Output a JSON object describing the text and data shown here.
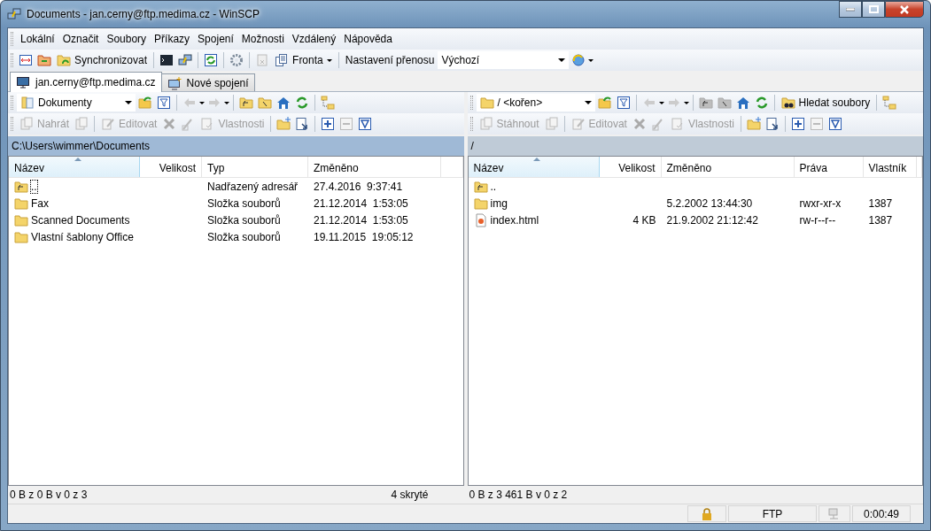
{
  "window": {
    "title": "Documents - jan.cerny@ftp.medima.cz - WinSCP"
  },
  "menu": [
    "Lokální",
    "Označit",
    "Soubory",
    "Příkazy",
    "Spojení",
    "Možnosti",
    "Vzdálený",
    "Nápověda"
  ],
  "toolbar": {
    "sync_label": "Synchronizovat",
    "queue_label": "Fronta",
    "transfer_label": "Nastavení přenosu",
    "transfer_value": "Výchozí"
  },
  "session_tabs": [
    {
      "label": "jan.cerny@ftp.medima.cz",
      "selected": true,
      "kind": "session"
    },
    {
      "label": "Nové spojení",
      "selected": false,
      "kind": "new"
    }
  ],
  "panels": [
    {
      "active": true,
      "location": "Dokumenty",
      "kind": "local",
      "path": "C:\\Users\\wimmer\\Documents",
      "buttons": [
        {
          "label": "Nahrát",
          "disabled": true,
          "kind": "transfer"
        },
        {
          "label": "Editovat",
          "disabled": true,
          "kind": "edit"
        },
        {
          "label": "Vlastnosti",
          "disabled": true,
          "kind": "properties"
        }
      ],
      "columns": [
        {
          "label": "Název",
          "kind": "name",
          "sorted": true
        },
        {
          "label": "Velikost",
          "kind": "size",
          "sorted": false
        },
        {
          "label": "Typ",
          "kind": "type",
          "sorted": false
        },
        {
          "label": "Změněno",
          "kind": "date",
          "sorted": false
        }
      ],
      "rows": [
        {
          "kind": "parent",
          "focused": true,
          "name": "..",
          "type": "Nadřazený adresář",
          "date": "27.4.2016  9:37:41"
        },
        {
          "kind": "folder",
          "focused": false,
          "name": "Fax",
          "type": "Složka souborů",
          "date": "21.12.2014  1:53:05"
        },
        {
          "kind": "folder",
          "focused": false,
          "name": "Scanned Documents",
          "type": "Složka souborů",
          "date": "21.12.2014  1:53:05"
        },
        {
          "kind": "folder",
          "focused": false,
          "name": "Vlastní šablony Office",
          "type": "Složka souborů",
          "date": "19.11.2015  19:05:12"
        }
      ],
      "status": "0 B z 0 B v 0 z 3",
      "hidden": "4 skryté"
    },
    {
      "active": false,
      "location": "/ <kořen>",
      "kind": "remote",
      "path": "/",
      "find_label": "Hledat soubory",
      "buttons": [
        {
          "label": "Stáhnout",
          "disabled": true,
          "kind": "transfer"
        },
        {
          "label": "Editovat",
          "disabled": true,
          "kind": "edit"
        },
        {
          "label": "Vlastnosti",
          "disabled": true,
          "kind": "properties"
        }
      ],
      "columns": [
        {
          "label": "Název",
          "kind": "name",
          "sorted": true
        },
        {
          "label": "Velikost",
          "kind": "size",
          "sorted": false
        },
        {
          "label": "Změněno",
          "kind": "date",
          "sorted": false
        },
        {
          "label": "Práva",
          "kind": "rights",
          "sorted": false
        },
        {
          "label": "Vlastník",
          "kind": "owner",
          "sorted": false
        }
      ],
      "rows": [
        {
          "kind": "parent",
          "focused": false,
          "name": ".."
        },
        {
          "kind": "folder",
          "focused": false,
          "name": "img",
          "date": "5.2.2002 13:44:30",
          "rights": "rwxr-xr-x",
          "owner": "1387"
        },
        {
          "kind": "file",
          "focused": false,
          "name": "index.html",
          "size": "4 KB",
          "date": "21.9.2002 21:12:42",
          "rights": "rw-r--r--",
          "owner": "1387"
        }
      ],
      "status": "0 B z 3 461 B v 0 z 2"
    }
  ],
  "status_bar": {
    "protocol": "FTP",
    "elapsed": "0:00:49"
  }
}
